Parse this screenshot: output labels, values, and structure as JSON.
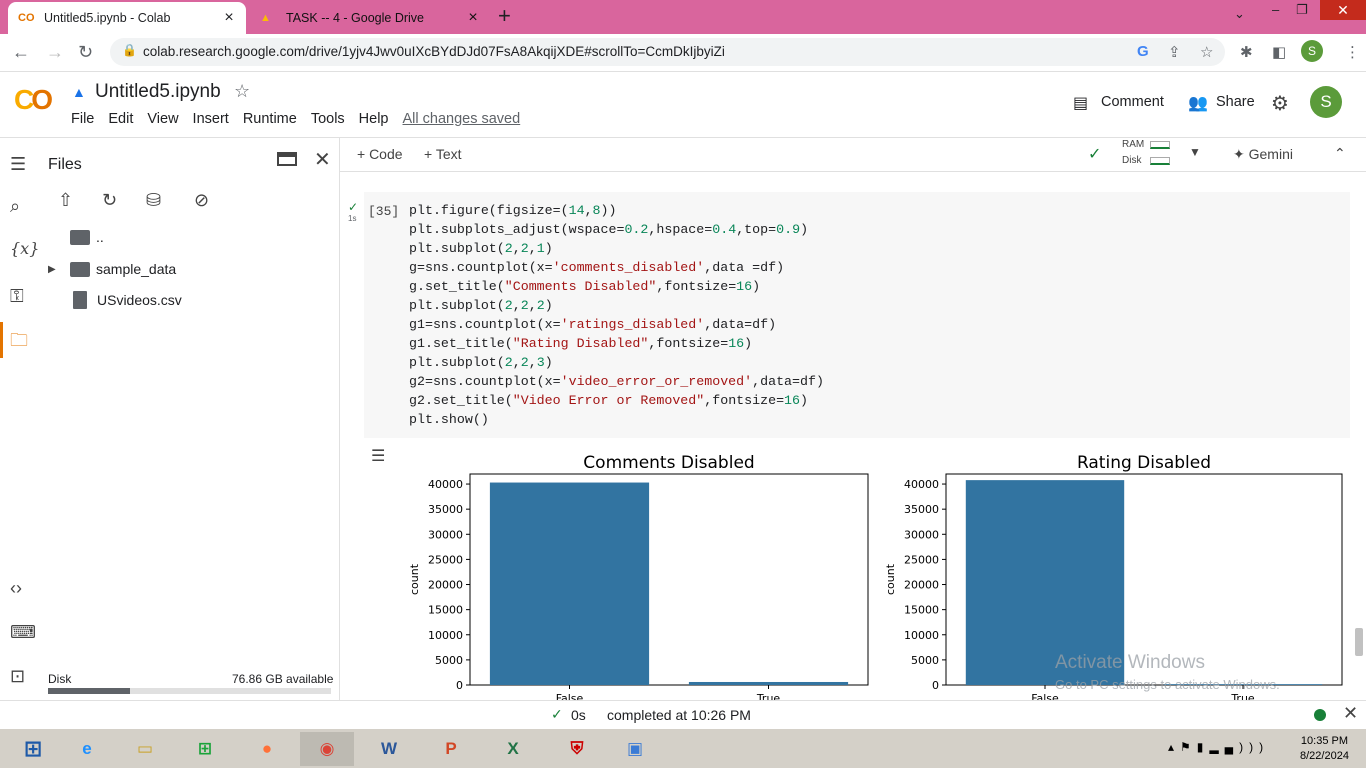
{
  "browser": {
    "tabs": [
      {
        "title": "Untitled5.ipynb - Colab",
        "favicon": "colab-icon"
      },
      {
        "title": "TASK -- 4 - Google Drive",
        "favicon": "drive-icon"
      }
    ],
    "url": "colab.research.google.com/drive/1yjv4Jwv0uIXcBYdDJd07FsA8AkqijXDE#scrollTo=CcmDkIjbyiZi",
    "profile_initial": "S"
  },
  "colab": {
    "notebook_title": "Untitled5.ipynb",
    "menu": [
      "File",
      "Edit",
      "View",
      "Insert",
      "Runtime",
      "Tools",
      "Help"
    ],
    "save_status": "All changes saved",
    "comment_label": "Comment",
    "share_label": "Share",
    "avatar_initial": "S",
    "toolbar": {
      "code_label": "+ Code",
      "text_label": "+ Text",
      "ram_label": "RAM",
      "disk_label": "Disk",
      "gemini_label": "Gemini"
    }
  },
  "files_panel": {
    "title": "Files",
    "items": [
      {
        "name": "..",
        "type": "folder"
      },
      {
        "name": "sample_data",
        "type": "folder"
      },
      {
        "name": "USvideos.csv",
        "type": "file"
      }
    ],
    "disk_label": "Disk",
    "disk_available": "76.86 GB available",
    "disk_used_fraction": 0.29
  },
  "cell": {
    "execution_count": "[35]",
    "exec_time": "1s",
    "code_lines": [
      "plt.figure(figsize=(14,8))",
      "plt.subplots_adjust(wspace=0.2,hspace=0.4,top=0.9)",
      "plt.subplot(2,2,1)",
      "g=sns.countplot(x='comments_disabled',data =df)",
      "g.set_title(\"Comments Disabled\",fontsize=16)",
      "plt.subplot(2,2,2)",
      "g1=sns.countplot(x='ratings_disabled',data=df)",
      "g1.set_title(\"Rating Disabled\",fontsize=16)",
      "plt.subplot(2,2,3)",
      "g2=sns.countplot(x='video_error_or_removed',data=df)",
      "g2.set_title(\"Video Error or Removed\",fontsize=16)",
      "plt.show()"
    ]
  },
  "chart_data": [
    {
      "type": "bar",
      "title": "Comments Disabled",
      "xlabel": "",
      "ylabel": "count",
      "categories": [
        "False",
        "True"
      ],
      "values": [
        40300,
        600
      ],
      "ylim": [
        0,
        42000
      ],
      "yticks": [
        0,
        5000,
        10000,
        15000,
        20000,
        25000,
        30000,
        35000,
        40000
      ],
      "color": "#3274a1"
    },
    {
      "type": "bar",
      "title": "Rating Disabled",
      "xlabel": "",
      "ylabel": "count",
      "categories": [
        "False",
        "True"
      ],
      "values": [
        40780,
        170
      ],
      "ylim": [
        0,
        42000
      ],
      "yticks": [
        0,
        5000,
        10000,
        15000,
        20000,
        25000,
        30000,
        35000,
        40000
      ],
      "color": "#3274a1"
    }
  ],
  "watermark": {
    "line1": "Activate Windows",
    "line2": "Go to PC settings to activate Windows."
  },
  "status": {
    "time": "0s",
    "completed": "completed at 10:26 PM"
  },
  "taskbar": {
    "time": "10:35 PM",
    "date": "8/22/2024"
  }
}
